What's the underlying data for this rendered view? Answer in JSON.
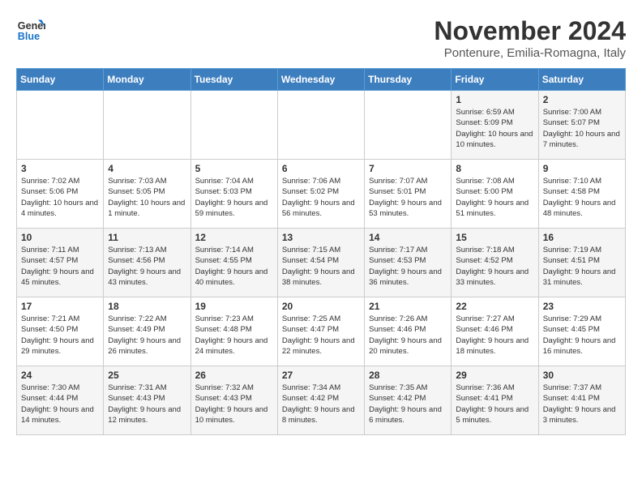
{
  "logo": {
    "line1": "General",
    "line2": "Blue"
  },
  "title": {
    "month_year": "November 2024",
    "location": "Pontenure, Emilia-Romagna, Italy"
  },
  "days_of_week": [
    "Sunday",
    "Monday",
    "Tuesday",
    "Wednesday",
    "Thursday",
    "Friday",
    "Saturday"
  ],
  "weeks": [
    [
      {
        "day": "",
        "info": ""
      },
      {
        "day": "",
        "info": ""
      },
      {
        "day": "",
        "info": ""
      },
      {
        "day": "",
        "info": ""
      },
      {
        "day": "",
        "info": ""
      },
      {
        "day": "1",
        "info": "Sunrise: 6:59 AM\nSunset: 5:09 PM\nDaylight: 10 hours and 10 minutes."
      },
      {
        "day": "2",
        "info": "Sunrise: 7:00 AM\nSunset: 5:07 PM\nDaylight: 10 hours and 7 minutes."
      }
    ],
    [
      {
        "day": "3",
        "info": "Sunrise: 7:02 AM\nSunset: 5:06 PM\nDaylight: 10 hours and 4 minutes."
      },
      {
        "day": "4",
        "info": "Sunrise: 7:03 AM\nSunset: 5:05 PM\nDaylight: 10 hours and 1 minute."
      },
      {
        "day": "5",
        "info": "Sunrise: 7:04 AM\nSunset: 5:03 PM\nDaylight: 9 hours and 59 minutes."
      },
      {
        "day": "6",
        "info": "Sunrise: 7:06 AM\nSunset: 5:02 PM\nDaylight: 9 hours and 56 minutes."
      },
      {
        "day": "7",
        "info": "Sunrise: 7:07 AM\nSunset: 5:01 PM\nDaylight: 9 hours and 53 minutes."
      },
      {
        "day": "8",
        "info": "Sunrise: 7:08 AM\nSunset: 5:00 PM\nDaylight: 9 hours and 51 minutes."
      },
      {
        "day": "9",
        "info": "Sunrise: 7:10 AM\nSunset: 4:58 PM\nDaylight: 9 hours and 48 minutes."
      }
    ],
    [
      {
        "day": "10",
        "info": "Sunrise: 7:11 AM\nSunset: 4:57 PM\nDaylight: 9 hours and 45 minutes."
      },
      {
        "day": "11",
        "info": "Sunrise: 7:13 AM\nSunset: 4:56 PM\nDaylight: 9 hours and 43 minutes."
      },
      {
        "day": "12",
        "info": "Sunrise: 7:14 AM\nSunset: 4:55 PM\nDaylight: 9 hours and 40 minutes."
      },
      {
        "day": "13",
        "info": "Sunrise: 7:15 AM\nSunset: 4:54 PM\nDaylight: 9 hours and 38 minutes."
      },
      {
        "day": "14",
        "info": "Sunrise: 7:17 AM\nSunset: 4:53 PM\nDaylight: 9 hours and 36 minutes."
      },
      {
        "day": "15",
        "info": "Sunrise: 7:18 AM\nSunset: 4:52 PM\nDaylight: 9 hours and 33 minutes."
      },
      {
        "day": "16",
        "info": "Sunrise: 7:19 AM\nSunset: 4:51 PM\nDaylight: 9 hours and 31 minutes."
      }
    ],
    [
      {
        "day": "17",
        "info": "Sunrise: 7:21 AM\nSunset: 4:50 PM\nDaylight: 9 hours and 29 minutes."
      },
      {
        "day": "18",
        "info": "Sunrise: 7:22 AM\nSunset: 4:49 PM\nDaylight: 9 hours and 26 minutes."
      },
      {
        "day": "19",
        "info": "Sunrise: 7:23 AM\nSunset: 4:48 PM\nDaylight: 9 hours and 24 minutes."
      },
      {
        "day": "20",
        "info": "Sunrise: 7:25 AM\nSunset: 4:47 PM\nDaylight: 9 hours and 22 minutes."
      },
      {
        "day": "21",
        "info": "Sunrise: 7:26 AM\nSunset: 4:46 PM\nDaylight: 9 hours and 20 minutes."
      },
      {
        "day": "22",
        "info": "Sunrise: 7:27 AM\nSunset: 4:46 PM\nDaylight: 9 hours and 18 minutes."
      },
      {
        "day": "23",
        "info": "Sunrise: 7:29 AM\nSunset: 4:45 PM\nDaylight: 9 hours and 16 minutes."
      }
    ],
    [
      {
        "day": "24",
        "info": "Sunrise: 7:30 AM\nSunset: 4:44 PM\nDaylight: 9 hours and 14 minutes."
      },
      {
        "day": "25",
        "info": "Sunrise: 7:31 AM\nSunset: 4:43 PM\nDaylight: 9 hours and 12 minutes."
      },
      {
        "day": "26",
        "info": "Sunrise: 7:32 AM\nSunset: 4:43 PM\nDaylight: 9 hours and 10 minutes."
      },
      {
        "day": "27",
        "info": "Sunrise: 7:34 AM\nSunset: 4:42 PM\nDaylight: 9 hours and 8 minutes."
      },
      {
        "day": "28",
        "info": "Sunrise: 7:35 AM\nSunset: 4:42 PM\nDaylight: 9 hours and 6 minutes."
      },
      {
        "day": "29",
        "info": "Sunrise: 7:36 AM\nSunset: 4:41 PM\nDaylight: 9 hours and 5 minutes."
      },
      {
        "day": "30",
        "info": "Sunrise: 7:37 AM\nSunset: 4:41 PM\nDaylight: 9 hours and 3 minutes."
      }
    ]
  ]
}
